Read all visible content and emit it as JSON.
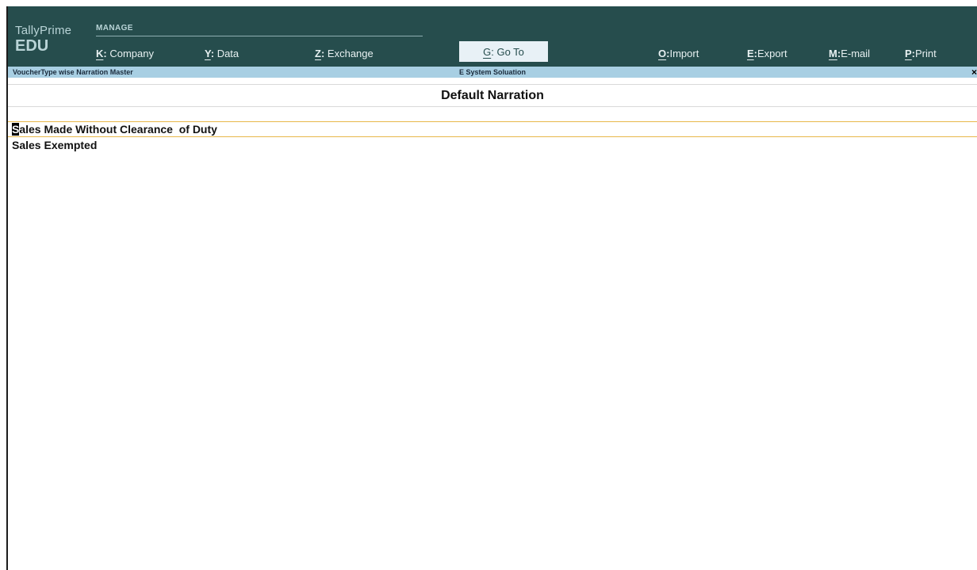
{
  "brand": {
    "name": "TallyPrime",
    "edition": "EDU"
  },
  "menu": {
    "section_label": "MANAGE",
    "items": [
      {
        "key": "K",
        "label": "Company"
      },
      {
        "key": "Y",
        "label": "Data"
      },
      {
        "key": "Z",
        "label": "Exchange"
      },
      {
        "key": "G",
        "label": "Go To"
      },
      {
        "key": "O",
        "label": "Import"
      },
      {
        "key": "E",
        "label": "Export"
      },
      {
        "key": "M",
        "label": "E-mail"
      },
      {
        "key": "P",
        "label": "Print"
      }
    ]
  },
  "titlebar": {
    "screen_name": "VoucherType wise Narration Master",
    "company": "E System Soluation",
    "close_symbol": "×"
  },
  "list": {
    "title": "Default Narration",
    "items": [
      {
        "first_char": "S",
        "rest": "ales Made Without Clearance  of Duty",
        "selected": true
      },
      {
        "first_char": "",
        "rest": "Sales Exempted",
        "selected": false
      }
    ]
  },
  "colors": {
    "topbar": "#264d4d",
    "titlebar": "#a8cfe3",
    "selection_border": "#e8b84a",
    "goto_button": "#e8f1f6"
  }
}
